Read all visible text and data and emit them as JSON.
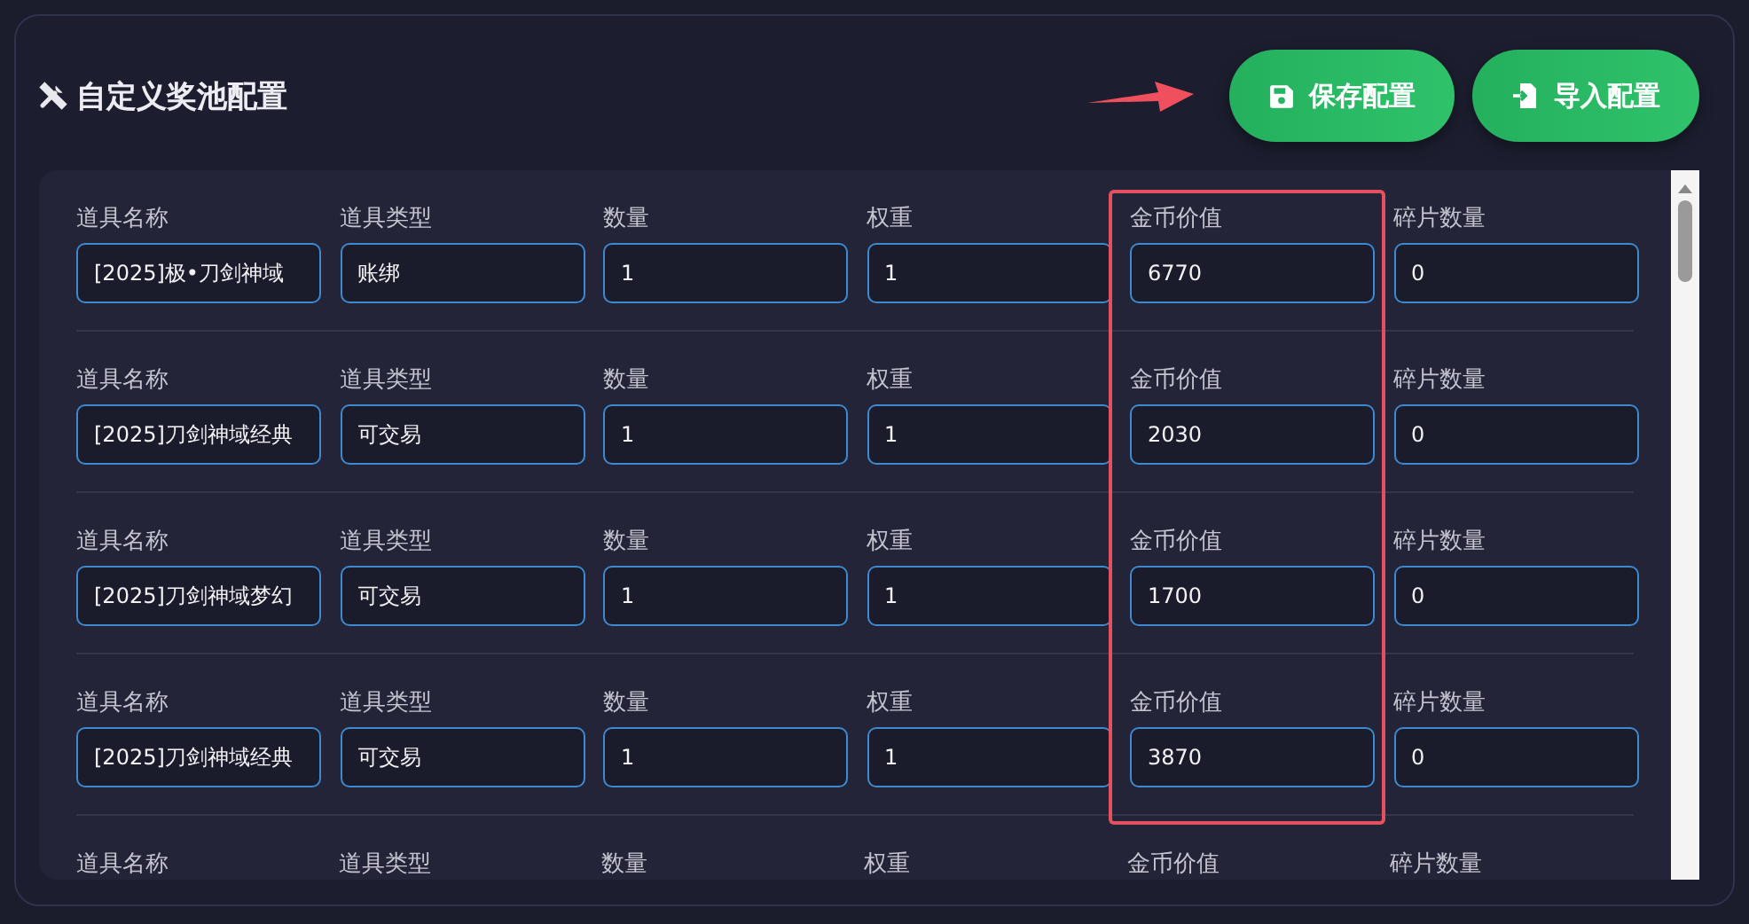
{
  "title": "自定义奖池配置",
  "buttons": [
    {
      "label": "保存配置",
      "kind": "save",
      "pointed": true
    },
    {
      "label": "导入配置",
      "kind": "import",
      "pointed": false
    }
  ],
  "rows": [
    {
      "fields": [
        {
          "label": "道具名称",
          "value": "[2025]极•刀剑神域",
          "highlighted": false
        },
        {
          "label": "道具类型",
          "value": "账绑",
          "highlighted": false
        },
        {
          "label": "数量",
          "value": "1",
          "highlighted": false
        },
        {
          "label": "权重",
          "value": "1",
          "highlighted": false
        },
        {
          "label": "金币价值",
          "value": "6770",
          "highlighted": true
        },
        {
          "label": "碎片数量",
          "value": "0",
          "highlighted": false
        }
      ]
    },
    {
      "fields": [
        {
          "label": "道具名称",
          "value": "[2025]刀剑神域经典",
          "highlighted": false
        },
        {
          "label": "道具类型",
          "value": "可交易",
          "highlighted": false
        },
        {
          "label": "数量",
          "value": "1",
          "highlighted": false
        },
        {
          "label": "权重",
          "value": "1",
          "highlighted": false
        },
        {
          "label": "金币价值",
          "value": "2030",
          "highlighted": true
        },
        {
          "label": "碎片数量",
          "value": "0",
          "highlighted": false
        }
      ]
    },
    {
      "fields": [
        {
          "label": "道具名称",
          "value": "[2025]刀剑神域梦幻",
          "highlighted": false
        },
        {
          "label": "道具类型",
          "value": "可交易",
          "highlighted": false
        },
        {
          "label": "数量",
          "value": "1",
          "highlighted": false
        },
        {
          "label": "权重",
          "value": "1",
          "highlighted": false
        },
        {
          "label": "金币价值",
          "value": "1700",
          "highlighted": true
        },
        {
          "label": "碎片数量",
          "value": "0",
          "highlighted": false
        }
      ]
    },
    {
      "fields": [
        {
          "label": "道具名称",
          "value": "[2025]刀剑神域经典",
          "highlighted": false
        },
        {
          "label": "道具类型",
          "value": "可交易",
          "highlighted": false
        },
        {
          "label": "数量",
          "value": "1",
          "highlighted": false
        },
        {
          "label": "权重",
          "value": "1",
          "highlighted": false
        },
        {
          "label": "金币价值",
          "value": "3870",
          "highlighted": true
        },
        {
          "label": "碎片数量",
          "value": "0",
          "highlighted": false
        }
      ]
    },
    {
      "fields": [
        {
          "label": "道具名称",
          "highlighted": false
        },
        {
          "label": "道具类型",
          "highlighted": false
        },
        {
          "label": "数量",
          "highlighted": false
        },
        {
          "label": "权重",
          "highlighted": false
        },
        {
          "label": "金币价值",
          "highlighted": false
        },
        {
          "label": "碎片数量",
          "highlighted": false
        }
      ]
    }
  ]
}
